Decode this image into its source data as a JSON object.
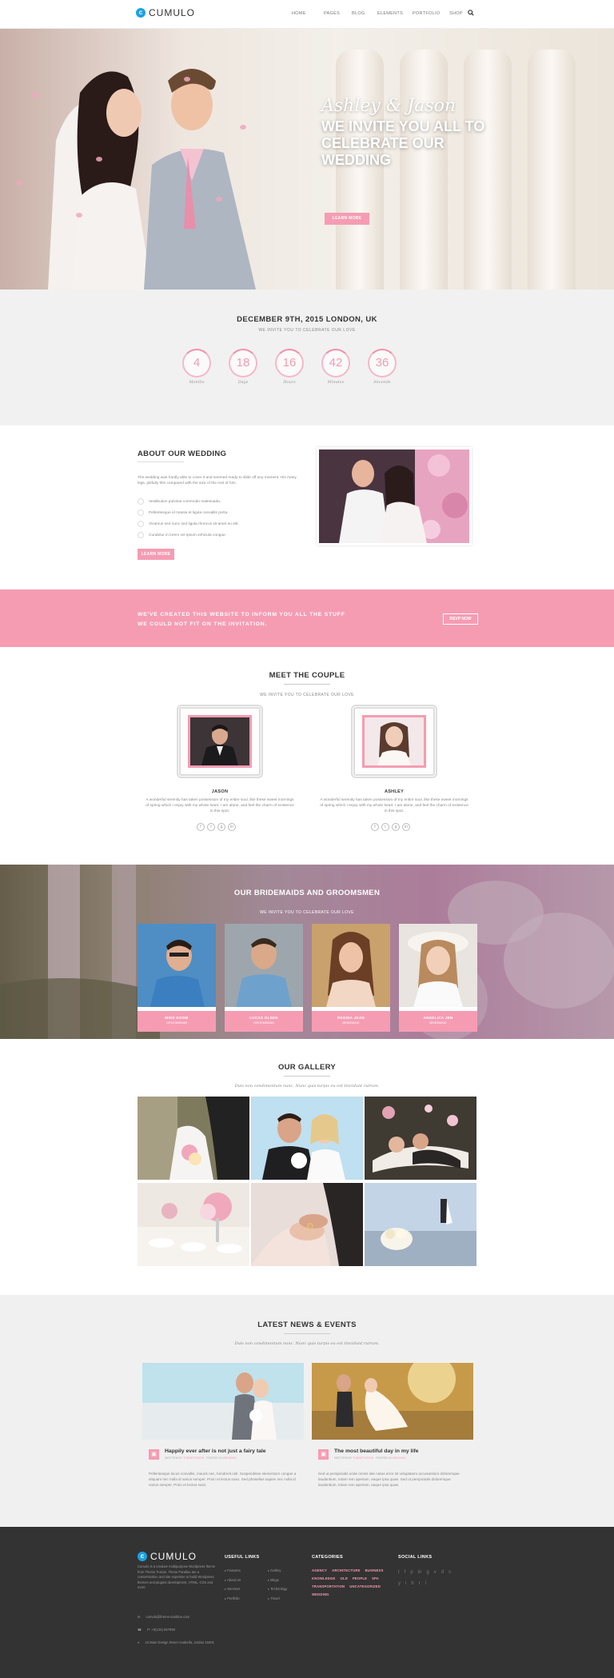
{
  "header": {
    "logo": "CUMULO",
    "nav": [
      "HOME",
      "PAGES",
      "BLOG",
      "ELEMENTS",
      "PORTFOLIO",
      "SHOP"
    ],
    "search_icon": "search-icon"
  },
  "hero": {
    "script_names": "Ashley & Jason",
    "headline": "WE INVITE YOU ALL TO CELEBRATE OUR WEDDING",
    "button": "LEARN MORE"
  },
  "countdown": {
    "title": "DECEMBER 9TH, 2015 LONDON, UK",
    "subtitle": "WE INVITE YOU TO CELEBRATE OUR LOVE",
    "units": [
      {
        "value": "4",
        "label": "Months"
      },
      {
        "value": "18",
        "label": "Days"
      },
      {
        "value": "16",
        "label": "Hours"
      },
      {
        "value": "42",
        "label": "Minutes"
      },
      {
        "value": "36",
        "label": "Seconds"
      }
    ]
  },
  "about": {
    "title": "ABOUT OUR WEDDING",
    "text": "The wedding was hardly able to cover it and seemed ready to slide off any moment. His many legs, pitifully thin compared with the size of the rest of him.",
    "items": [
      "Vestibulum pulvinar commodo malesuada.",
      "Pellentesque id massa et ligula convallis porta.",
      "Vivamus sed nunc sed ligula rhoncus sit amet eu elit.",
      "Curabitur in lorem vel ipsum vehicula congue."
    ],
    "button": "LEARN MORE"
  },
  "banner": {
    "line1": "WE'VE CREATED THIS WEBSITE TO INFORM YOU ALL THE STUFF",
    "line2": "WE COULD NOT FIT ON THE INVITATION.",
    "button": "RSVP NOW"
  },
  "couple": {
    "title": "MEET THE COUPLE",
    "subtitle": "WE INVITE YOU TO CELEBRATE OUR LOVE",
    "people": [
      {
        "name": "JASON",
        "text": "A wonderful serenity has taken possession of my entire soul, like these sweet mornings of spring which I enjoy with my whole heart. I am alone, and feel the charm of existence in this spot."
      },
      {
        "name": "ASHLEY",
        "text": "A wonderful serenity has taken possession of my entire soul, like these sweet mornings of spring which I enjoy with my whole heart. I am alone, and feel the charm of existence in this spot."
      }
    ],
    "social_icons": [
      "f",
      "t",
      "g",
      "in"
    ]
  },
  "bridesmaids": {
    "title": "OUR BRIDEMAIDS AND GROOMSMEN",
    "subtitle": "WE INVITE YOU TO CELEBRATE OUR LOVE",
    "cards": [
      {
        "name": "MIKE DOOM",
        "role": "GROOMSMAN"
      },
      {
        "name": "LUCAS OLSEN",
        "role": "GROOMSMAN"
      },
      {
        "name": "REGINA JEAN",
        "role": "BRIDEMAID"
      },
      {
        "name": "ANGELICA JEN",
        "role": "BRIDEMAID"
      }
    ]
  },
  "gallery": {
    "title": "OUR GALLERY",
    "subtitle": "Duis non condimentum nunc. Nunc quis turpis eu est tincidunt rutrum."
  },
  "news": {
    "title": "LATEST NEWS & EVENTS",
    "subtitle": "Duis non condimentum nunc. Nunc quis turpis eu est tincidunt rutrum.",
    "posts": [
      {
        "title": "Happily ever after is not just a fairy tale",
        "meta_by": "WRITTEN BY",
        "author": "THEMEFUSION",
        "meta_in": "POSTED IN",
        "category": "WEDDING",
        "text": "Pellentesque lacus convallis, mauris nec, hendrerit nisl. Suspendisse elementum congue a aliquam nec nulla id varius semper. Proin et lectus suso. Sed phasellus sapien nec nulla id varius semper. Proin et lectus suso."
      },
      {
        "title": "The most beautiful day in my life",
        "meta_by": "WRITTEN BY",
        "author": "THEMEFUSION",
        "meta_in": "POSTED IN",
        "category": "WEDDING",
        "text": "Sed ut perspiciatis unde omnis iste natus error sit voluptatem accusantium doloremque laudantium, totam rem aperiam, eaque ipsa quae. Sed ut perspiciatis doloremque laudantium, totam rem aperiam, eaque ipsa quae."
      }
    ]
  },
  "footer": {
    "logo": "CUMULO",
    "about": "Cumulo is a creative multipurpose Wordpress theme from Theme Fusion. These Parallax are a customisation and site expertise to build Wordpress themes and plugins development, HTML, CSS and more.",
    "email": "cumulo@theme-sanblue.com",
    "phone": "P: +0(134) 567890",
    "address": "15 Main Design Street Anabella, Jordan 10401",
    "useful_title": "USEFUL LINKS",
    "links_col1": [
      "Features",
      "About Us",
      "Services",
      "Portfolio"
    ],
    "links_col2": [
      "Gallery",
      "Blogs",
      "Technology",
      "Travel"
    ],
    "categories_title": "CATEGORIES",
    "categories": [
      "AGENCY",
      "ARCHITECTURE",
      "BUSINESS",
      "KNOWLEDGE",
      "OLD",
      "PEOPLE",
      "SPA",
      "TRANSPORTATION",
      "UNCATEGORIZED",
      "WEDDING"
    ],
    "social_title": "SOCIAL LINKS",
    "social_row1": [
      "t",
      "f",
      "p",
      "in",
      "g",
      "v",
      "d",
      "s"
    ],
    "social_row2": [
      "y",
      "i",
      "b",
      "r",
      "l"
    ]
  },
  "colors": {
    "accent": "#f59cb3",
    "footer_bg": "#333333",
    "logo": "#1da1e2"
  }
}
